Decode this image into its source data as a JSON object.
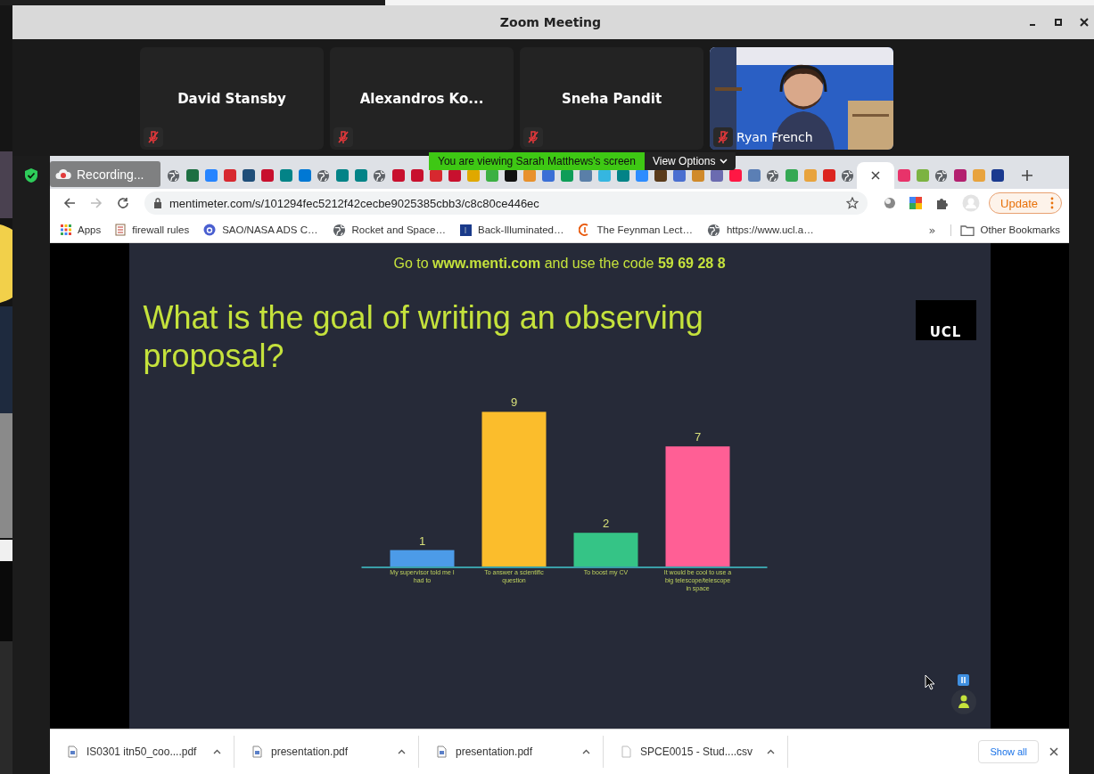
{
  "window": {
    "title": "Zoom Meeting"
  },
  "participants": [
    {
      "name": "David Stansby",
      "muted": true
    },
    {
      "name": "Alexandros Ko...",
      "muted": true
    },
    {
      "name": "Sneha Pandit",
      "muted": true
    },
    {
      "name": "Ryan French",
      "muted": true
    }
  ],
  "recording": {
    "label": "Recording..."
  },
  "share_banner": {
    "message": "You are viewing Sarah Matthews's screen",
    "options": "View Options"
  },
  "browser": {
    "tabs": [
      {
        "kind": "globe",
        "selected": false
      },
      {
        "kind": "shape",
        "color": "#1d6f42",
        "selected": false
      },
      {
        "kind": "shape",
        "color": "#2684ff",
        "selected": false
      },
      {
        "kind": "shape",
        "color": "#d7282f",
        "selected": false
      },
      {
        "kind": "shape",
        "color": "#1f4e79",
        "selected": false
      },
      {
        "kind": "shape",
        "color": "#c8102e",
        "selected": false
      },
      {
        "kind": "shape",
        "color": "#038387",
        "selected": false
      },
      {
        "kind": "shape",
        "color": "#0078d4",
        "selected": false
      },
      {
        "kind": "globe",
        "selected": false
      },
      {
        "kind": "shape",
        "color": "#038387",
        "selected": false
      },
      {
        "kind": "shape",
        "color": "#038387",
        "selected": false
      },
      {
        "kind": "globe",
        "selected": false
      },
      {
        "kind": "shape",
        "color": "#c8102e",
        "selected": false
      },
      {
        "kind": "shape",
        "color": "#c8102e",
        "selected": false
      },
      {
        "kind": "shape",
        "color": "#d7282f",
        "selected": false
      },
      {
        "kind": "shape",
        "color": "#c8102e",
        "selected": false
      },
      {
        "kind": "shape",
        "color": "#e0a800",
        "selected": false
      },
      {
        "kind": "shape",
        "color": "#3cb043",
        "selected": false
      },
      {
        "kind": "shape",
        "color": "#111111",
        "selected": false
      },
      {
        "kind": "shape",
        "color": "#e8912d",
        "selected": false
      },
      {
        "kind": "shape",
        "color": "#3b6fd6",
        "selected": false
      },
      {
        "kind": "shape",
        "color": "#0f9d58",
        "selected": false
      },
      {
        "kind": "shape",
        "color": "#5a7fa8",
        "selected": false
      },
      {
        "kind": "shape",
        "color": "#35b6e0",
        "selected": false
      },
      {
        "kind": "shape",
        "color": "#038387",
        "selected": false
      },
      {
        "kind": "shape",
        "color": "#2d8cff",
        "selected": false
      },
      {
        "kind": "shape",
        "color": "#5a3b1a",
        "selected": false
      },
      {
        "kind": "shape",
        "color": "#4a6fd0",
        "selected": false
      },
      {
        "kind": "shape",
        "color": "#d08a2a",
        "selected": false
      },
      {
        "kind": "shape",
        "color": "#6b6bb0",
        "selected": false
      },
      {
        "kind": "shape",
        "color": "#ff1744",
        "selected": false
      },
      {
        "kind": "shape",
        "color": "#5b7fb5",
        "selected": false
      },
      {
        "kind": "globe",
        "selected": false
      },
      {
        "kind": "shape",
        "color": "#34a853",
        "selected": false
      },
      {
        "kind": "shape",
        "color": "#e8a33d",
        "selected": false
      },
      {
        "kind": "shape",
        "color": "#dc241f",
        "selected": false
      },
      {
        "kind": "globe",
        "selected": false
      },
      {
        "kind": "blank",
        "selected": true
      },
      {
        "kind": "shape",
        "color": "#e8336a",
        "selected": false
      },
      {
        "kind": "shape",
        "color": "#7cb342",
        "selected": false
      },
      {
        "kind": "globe",
        "selected": false
      },
      {
        "kind": "shape",
        "color": "#b3206f",
        "selected": false
      },
      {
        "kind": "shape",
        "color": "#e8a33d",
        "selected": false
      },
      {
        "kind": "shape",
        "color": "#1a3a8f",
        "selected": false
      }
    ],
    "url": "mentimeter.com/s/101294fec5212f42cecbe9025385cbb3/c8c80ce446ec",
    "update_label": "Update",
    "bookmarks": [
      {
        "label": "Apps"
      },
      {
        "label": "firewall rules"
      },
      {
        "label": "SAO/NASA ADS C…"
      },
      {
        "label": "Rocket and Space…"
      },
      {
        "label": "Back-Illuminated…"
      },
      {
        "label": "The Feynman Lect…"
      },
      {
        "label": "https://www.ucl.a…"
      }
    ],
    "bookmarks_more": "»",
    "other_bookmarks": "Other Bookmarks"
  },
  "slide": {
    "instruction": "Go to **www.menti.com** and use the code **59 69 28 8**",
    "question": "What is the goal of writing an observing proposal?",
    "logo": "UCL",
    "chart_data": {
      "type": "bar",
      "categories": [
        "My supervisor told me I had to",
        "To answer a scientific question",
        "To boost my CV",
        "It would be cool to use a big telescope/telescope in space"
      ],
      "values": [
        1,
        9,
        2,
        7
      ],
      "colors": [
        "#4c9be8",
        "#fbbd2c",
        "#35c486",
        "#ff5f95"
      ],
      "data_labels": true
    }
  },
  "downloads": {
    "items": [
      {
        "name": "IS0301 itn50_coo....pdf"
      },
      {
        "name": "presentation.pdf"
      },
      {
        "name": "presentation.pdf"
      },
      {
        "name": "SPCE0015 - Stud....csv"
      }
    ],
    "show_all": "Show all"
  }
}
